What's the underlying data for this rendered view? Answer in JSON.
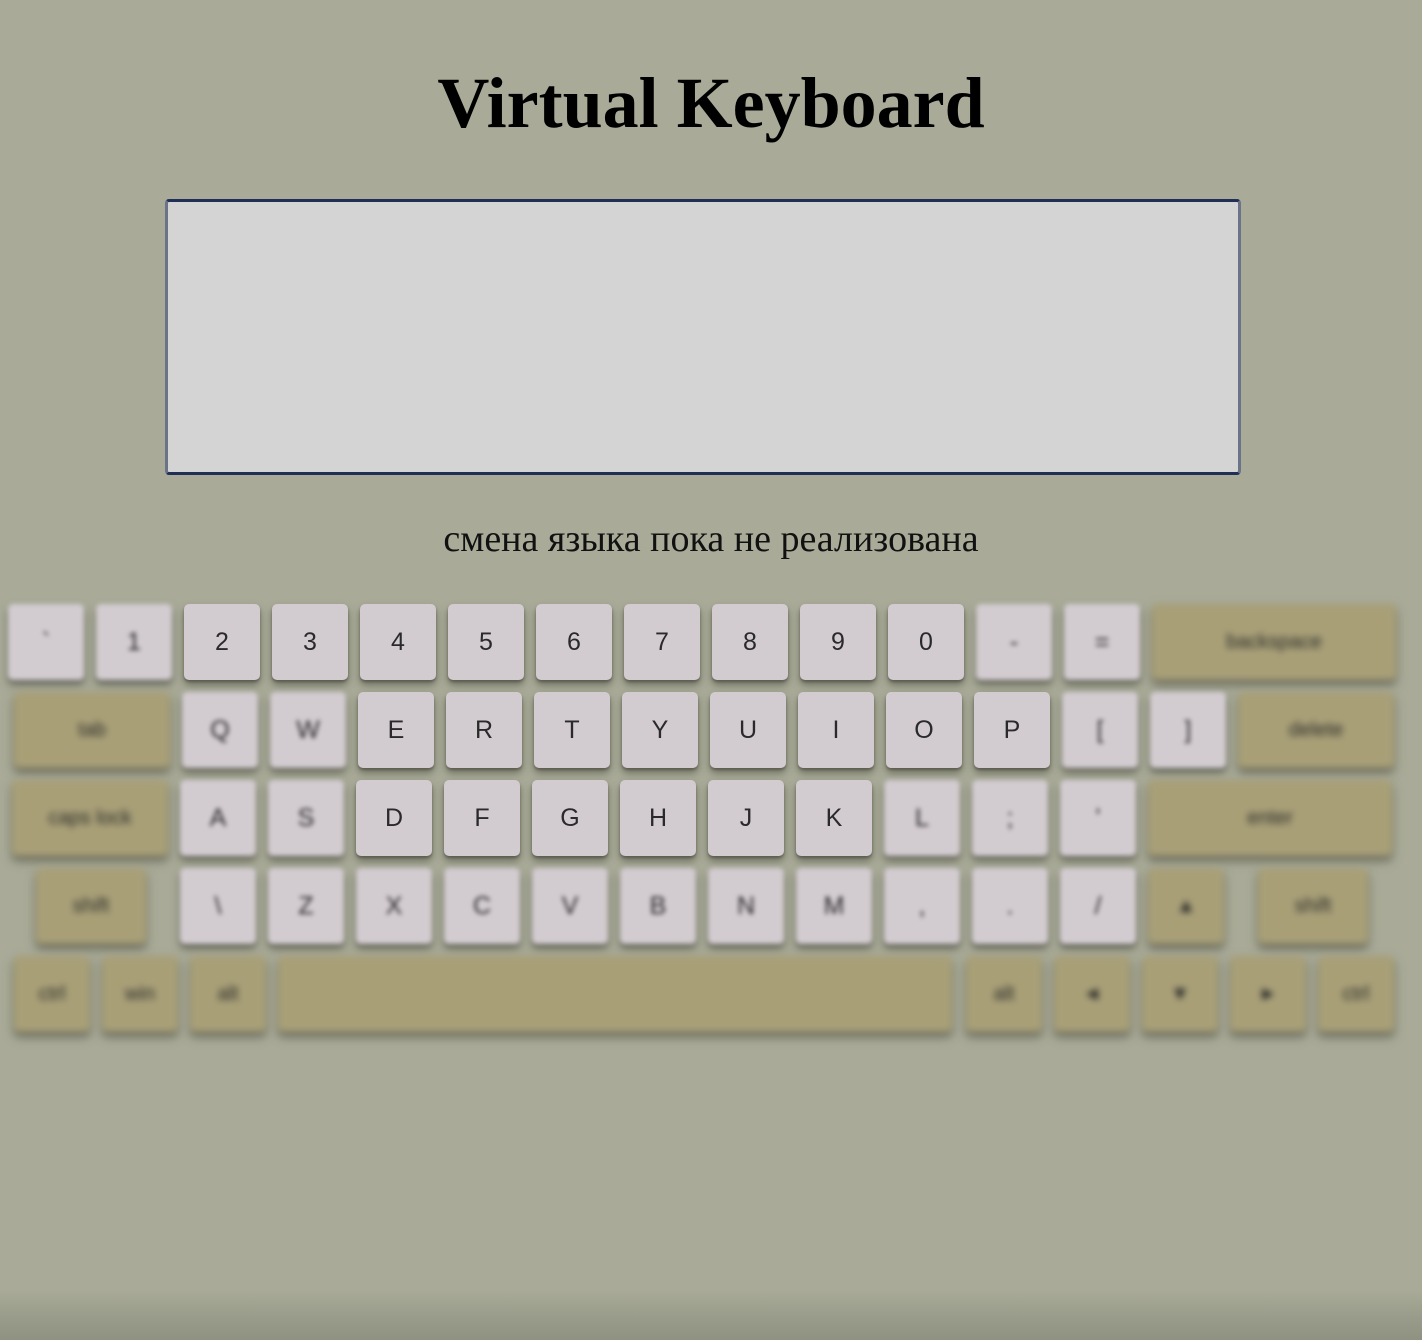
{
  "page": {
    "title": "Virtual Keyboard",
    "notice": "смена языка пока не реализована",
    "textarea_value": ""
  },
  "colors": {
    "background": "#a9ab98",
    "textarea_bg": "#d4d4d4",
    "char_key": "#d2cbd0",
    "function_key": "#a89f77"
  },
  "keyboard": {
    "rows": [
      [
        {
          "label": "`",
          "type": "char",
          "name": "key-backquote"
        },
        {
          "label": "1",
          "type": "char",
          "name": "key-1"
        },
        {
          "label": "2",
          "type": "char",
          "name": "key-2"
        },
        {
          "label": "3",
          "type": "char",
          "name": "key-3"
        },
        {
          "label": "4",
          "type": "char",
          "name": "key-4"
        },
        {
          "label": "5",
          "type": "char",
          "name": "key-5"
        },
        {
          "label": "6",
          "type": "char",
          "name": "key-6"
        },
        {
          "label": "7",
          "type": "char",
          "name": "key-7"
        },
        {
          "label": "8",
          "type": "char",
          "name": "key-8"
        },
        {
          "label": "9",
          "type": "char",
          "name": "key-9"
        },
        {
          "label": "0",
          "type": "char",
          "name": "key-0"
        },
        {
          "label": "-",
          "type": "char",
          "name": "key-minus"
        },
        {
          "label": "=",
          "type": "char",
          "name": "key-equal"
        },
        {
          "label": "backspace",
          "type": "func",
          "name": "key-backspace"
        }
      ],
      [
        {
          "label": "tab",
          "type": "func",
          "name": "key-tab"
        },
        {
          "label": "Q",
          "type": "char",
          "name": "key-q"
        },
        {
          "label": "W",
          "type": "char",
          "name": "key-w"
        },
        {
          "label": "E",
          "type": "char",
          "name": "key-e"
        },
        {
          "label": "R",
          "type": "char",
          "name": "key-r"
        },
        {
          "label": "T",
          "type": "char",
          "name": "key-t"
        },
        {
          "label": "Y",
          "type": "char",
          "name": "key-y"
        },
        {
          "label": "U",
          "type": "char",
          "name": "key-u"
        },
        {
          "label": "I",
          "type": "char",
          "name": "key-i"
        },
        {
          "label": "O",
          "type": "char",
          "name": "key-o"
        },
        {
          "label": "P",
          "type": "char",
          "name": "key-p"
        },
        {
          "label": "[",
          "type": "char",
          "name": "key-bracket-left"
        },
        {
          "label": "]",
          "type": "char",
          "name": "key-bracket-right"
        },
        {
          "label": "delete",
          "type": "func",
          "name": "key-delete"
        }
      ],
      [
        {
          "label": "caps lock",
          "type": "func",
          "name": "key-caps-lock"
        },
        {
          "label": "A",
          "type": "char",
          "name": "key-a"
        },
        {
          "label": "S",
          "type": "char",
          "name": "key-s"
        },
        {
          "label": "D",
          "type": "char",
          "name": "key-d"
        },
        {
          "label": "F",
          "type": "char",
          "name": "key-f"
        },
        {
          "label": "G",
          "type": "char",
          "name": "key-g"
        },
        {
          "label": "H",
          "type": "char",
          "name": "key-h"
        },
        {
          "label": "J",
          "type": "char",
          "name": "key-j"
        },
        {
          "label": "K",
          "type": "char",
          "name": "key-k"
        },
        {
          "label": "L",
          "type": "char",
          "name": "key-l"
        },
        {
          "label": ";",
          "type": "char",
          "name": "key-semicolon"
        },
        {
          "label": "'",
          "type": "char",
          "name": "key-quote"
        },
        {
          "label": "enter",
          "type": "func",
          "name": "key-enter"
        }
      ],
      [
        {
          "label": "shift",
          "type": "func",
          "name": "key-shift-left"
        },
        {
          "label": "\\",
          "type": "char",
          "name": "key-backslash"
        },
        {
          "label": "Z",
          "type": "char",
          "name": "key-z"
        },
        {
          "label": "X",
          "type": "char",
          "name": "key-x"
        },
        {
          "label": "C",
          "type": "char",
          "name": "key-c"
        },
        {
          "label": "V",
          "type": "char",
          "name": "key-v"
        },
        {
          "label": "B",
          "type": "char",
          "name": "key-b"
        },
        {
          "label": "N",
          "type": "char",
          "name": "key-n"
        },
        {
          "label": "M",
          "type": "char",
          "name": "key-m"
        },
        {
          "label": ",",
          "type": "char",
          "name": "key-comma"
        },
        {
          "label": ".",
          "type": "char",
          "name": "key-period"
        },
        {
          "label": "/",
          "type": "char",
          "name": "key-slash"
        },
        {
          "label": "▲",
          "type": "func",
          "name": "key-arrow-up"
        },
        {
          "label": "shift",
          "type": "func",
          "name": "key-shift-right"
        }
      ],
      [
        {
          "label": "ctrl",
          "type": "func",
          "name": "key-ctrl-left"
        },
        {
          "label": "win",
          "type": "func",
          "name": "key-win"
        },
        {
          "label": "alt",
          "type": "func",
          "name": "key-alt-left"
        },
        {
          "label": "",
          "type": "func",
          "name": "key-space"
        },
        {
          "label": "alt",
          "type": "func",
          "name": "key-alt-right"
        },
        {
          "label": "◄",
          "type": "func",
          "name": "key-arrow-left"
        },
        {
          "label": "▼",
          "type": "func",
          "name": "key-arrow-down"
        },
        {
          "label": "►",
          "type": "func",
          "name": "key-arrow-right"
        },
        {
          "label": "ctrl",
          "type": "func",
          "name": "key-ctrl-right"
        }
      ]
    ]
  }
}
